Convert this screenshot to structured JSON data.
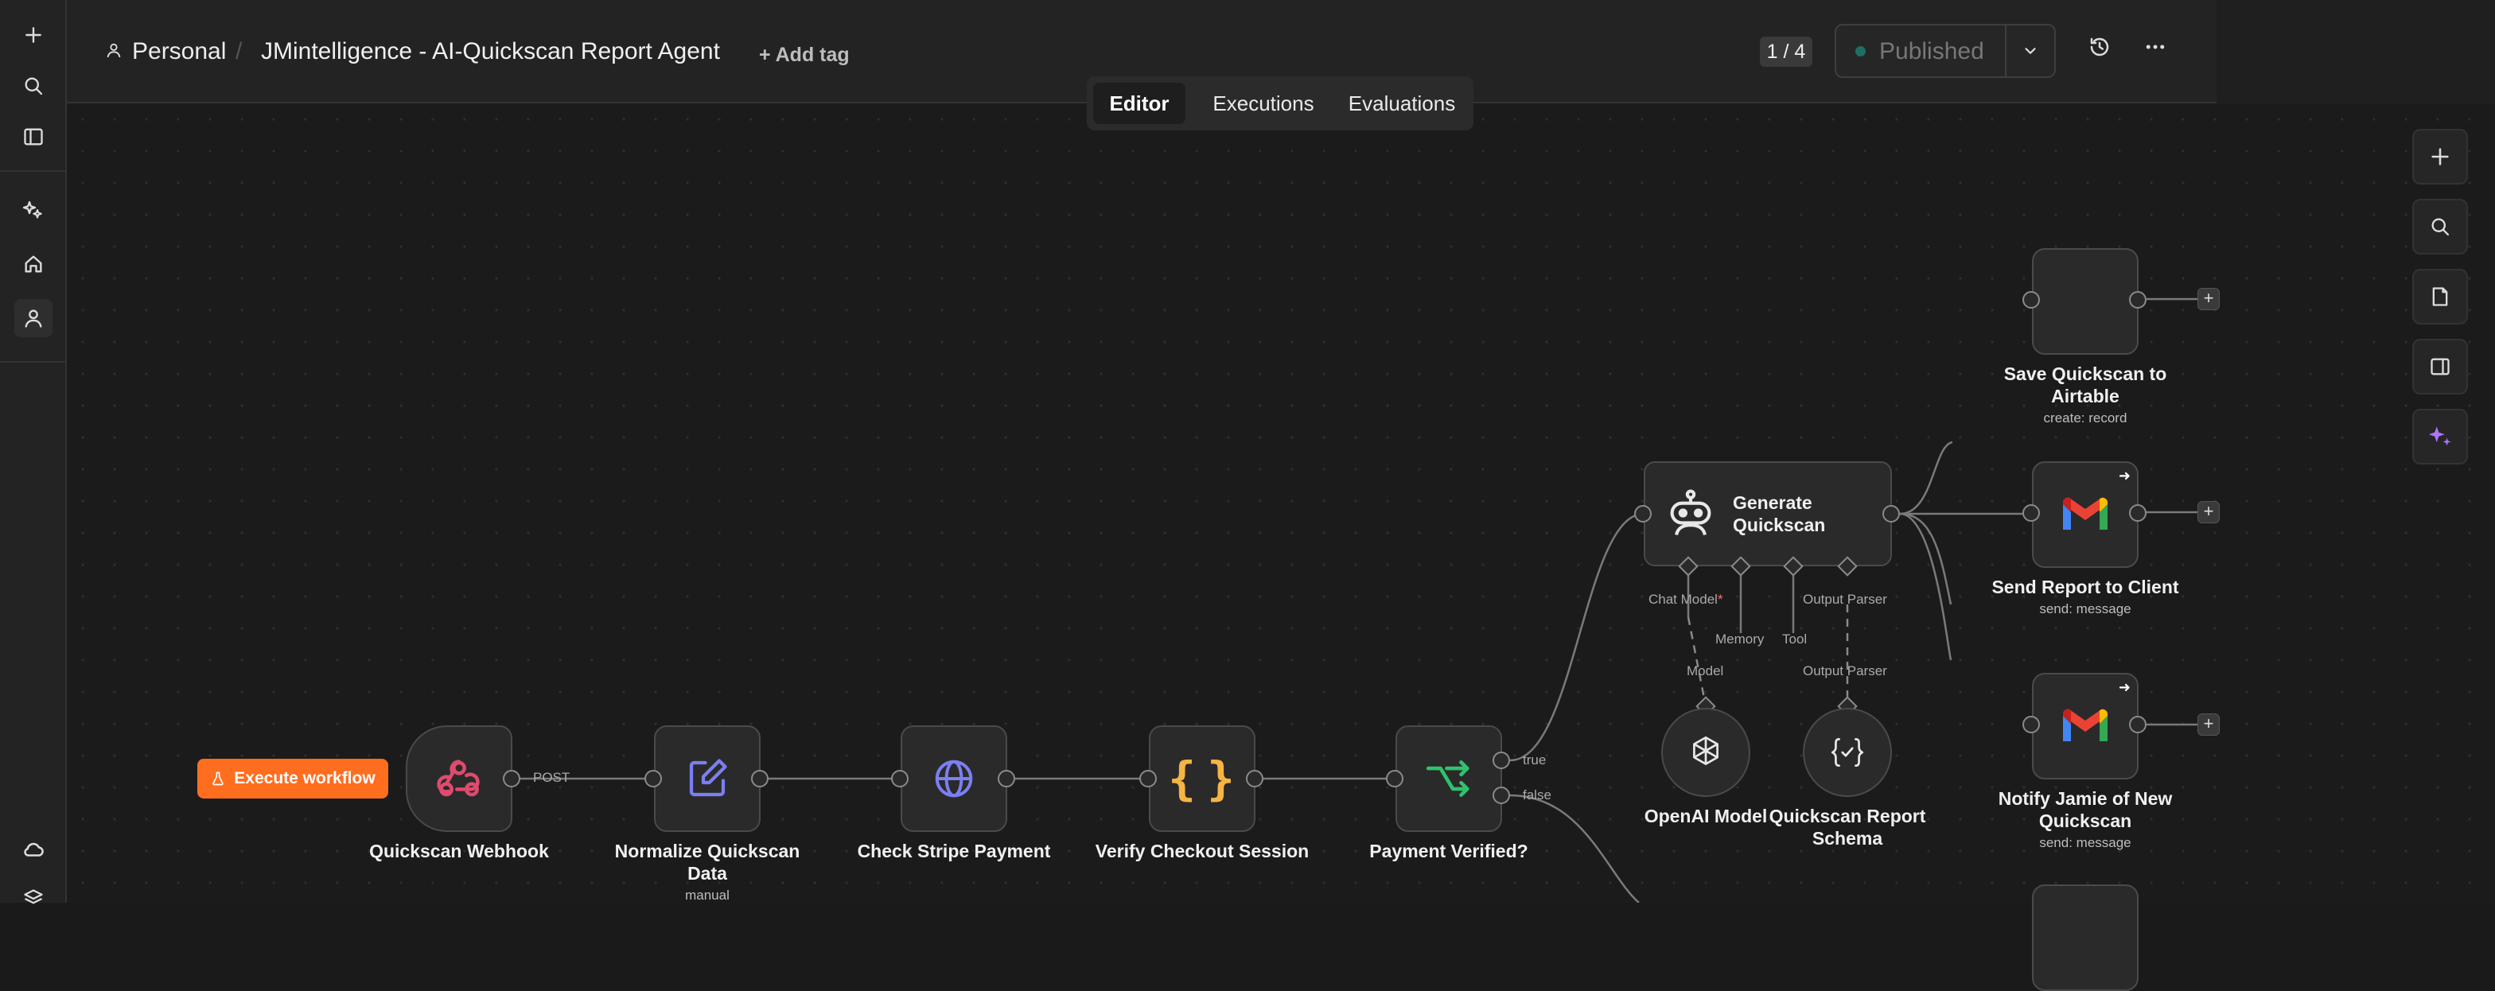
{
  "header": {
    "breadcrumb_project": "Personal",
    "breadcrumb_separator": "/",
    "workflow_name": "JMintelligence - AI-Quickscan Report Agent",
    "add_tag": "+ Add tag",
    "version_counter": "1 / 4",
    "publish_status": "Published"
  },
  "tabs": [
    {
      "label": "Editor",
      "active": true
    },
    {
      "label": "Executions",
      "active": false
    },
    {
      "label": "Evaluations",
      "active": false
    }
  ],
  "execute_button": "Execute workflow",
  "connection_labels": {
    "post": "POST",
    "true": "true",
    "false": "false"
  },
  "nodes": {
    "webhook": {
      "name": "Quickscan Webhook",
      "icon": "webhook-icon"
    },
    "normalize": {
      "name": "Normalize Quickscan Data",
      "subtitle": "manual",
      "icon": "edit-icon"
    },
    "stripe": {
      "name": "Check Stripe Payment",
      "icon": "globe-icon"
    },
    "verify": {
      "name": "Verify Checkout Session",
      "icon": "code-braces-icon"
    },
    "payment_if": {
      "name": "Payment Verified?",
      "icon": "if-branch-icon"
    },
    "agent": {
      "name": "Generate Quickscan",
      "icon": "robot-icon"
    },
    "airtable": {
      "name": "Save Quickscan to Airtable",
      "subtitle": "create: record"
    },
    "send_report": {
      "name": "Send Report to Client",
      "subtitle": "send: message",
      "icon": "gmail-icon"
    },
    "notify": {
      "name": "Notify Jamie of New Quickscan",
      "subtitle": "send: message",
      "icon": "gmail-icon"
    },
    "openai": {
      "name": "OpenAI Model",
      "icon": "openai-icon"
    },
    "schema": {
      "name": "Quickscan Report Schema",
      "icon": "schema-braces-icon"
    }
  },
  "agent_ports": {
    "chat_model": "Chat Model",
    "required_mark": "*",
    "memory": "Memory",
    "tool": "Tool",
    "output_parser": "Output Parser",
    "model_link": "Model",
    "output_parser_link": "Output Parser"
  },
  "colors": {
    "accent_orange": "#ff6d1f",
    "webhook_pink": "#e04a6e",
    "edit_purple": "#7b7ff2",
    "code_yellow": "#f5b544",
    "if_green": "#2ec26e",
    "ai_purple": "#b072ff",
    "published_dot": "#1f6e66"
  }
}
